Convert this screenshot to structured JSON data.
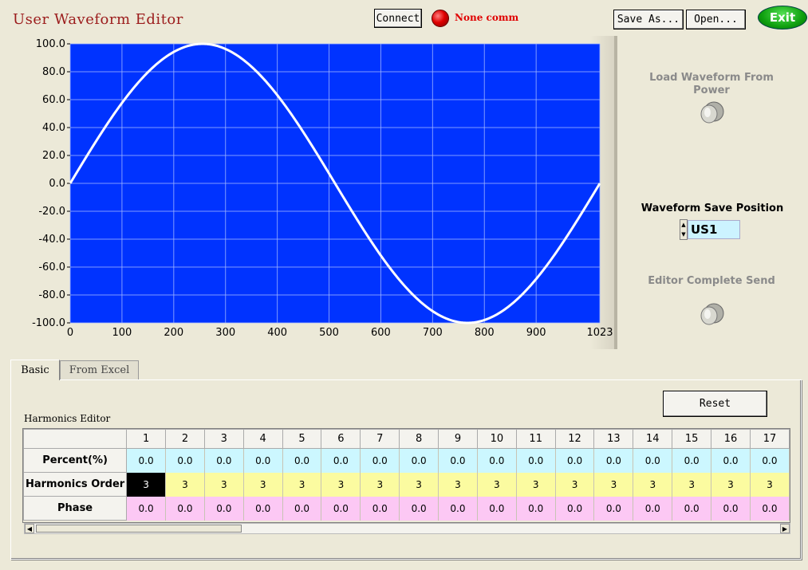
{
  "app": {
    "title": "User Waveform Editor"
  },
  "toolbar": {
    "connect_label": "Connect",
    "status_text": "None comm",
    "save_as_label": "Save As...",
    "open_label": "Open...",
    "exit_label": "Exit"
  },
  "side": {
    "load_label": "Load Waveform From Power",
    "save_position_label": "Waveform Save Position",
    "save_position_value": "US1",
    "editor_send_label": "Editor Complete Send",
    "spin_up_icon": "triangle-up",
    "spin_down_icon": "triangle-down"
  },
  "tabs": [
    {
      "label": "Basic",
      "active": true
    },
    {
      "label": "From Excel",
      "active": false
    }
  ],
  "panel": {
    "reset_label": "Reset",
    "editor_title": "Harmonics Editor"
  },
  "table": {
    "columns": [
      "1",
      "2",
      "3",
      "4",
      "5",
      "6",
      "7",
      "8",
      "9",
      "10",
      "11",
      "12",
      "13",
      "14",
      "15",
      "16",
      "17"
    ],
    "rows": [
      {
        "label": "Percent(%)",
        "values": [
          "0.0",
          "0.0",
          "0.0",
          "0.0",
          "0.0",
          "0.0",
          "0.0",
          "0.0",
          "0.0",
          "0.0",
          "0.0",
          "0.0",
          "0.0",
          "0.0",
          "0.0",
          "0.0",
          "0.0"
        ]
      },
      {
        "label": "Harmonics Order",
        "values": [
          "3",
          "3",
          "3",
          "3",
          "3",
          "3",
          "3",
          "3",
          "3",
          "3",
          "3",
          "3",
          "3",
          "3",
          "3",
          "3",
          "3"
        ]
      },
      {
        "label": "Phase",
        "values": [
          "0.0",
          "0.0",
          "0.0",
          "0.0",
          "0.0",
          "0.0",
          "0.0",
          "0.0",
          "0.0",
          "0.0",
          "0.0",
          "0.0",
          "0.0",
          "0.0",
          "0.0",
          "0.0",
          "0.0"
        ]
      }
    ],
    "selected_cell": {
      "row": 1,
      "col": 0
    }
  },
  "colors": {
    "plot_background": "#0033ff",
    "trace": "#ffffff",
    "title": "#9b1b1b",
    "status": "#e00000"
  },
  "chart_data": {
    "type": "line",
    "title": "",
    "xlabel": "",
    "ylabel": "",
    "xlim": [
      0,
      1023
    ],
    "ylim": [
      -100,
      100
    ],
    "grid": true,
    "x_ticks": [
      "0",
      "100",
      "200",
      "300",
      "400",
      "500",
      "600",
      "700",
      "800",
      "900",
      "1023"
    ],
    "y_ticks": [
      "100.0",
      "80.0",
      "60.0",
      "40.0",
      "20.0",
      "0.0",
      "-20.0",
      "-40.0",
      "-60.0",
      "-80.0",
      "-100.0"
    ],
    "series": [
      {
        "waveform": "sine",
        "amplitude": 100,
        "period": 1023,
        "phase": 0
      }
    ]
  }
}
